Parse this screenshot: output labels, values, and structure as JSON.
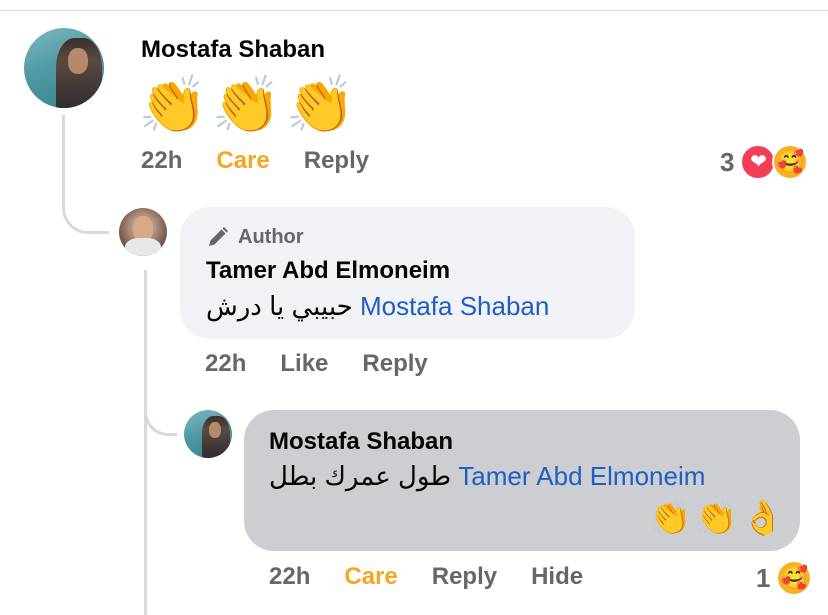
{
  "comment": {
    "author": "Mostafa Shaban",
    "content": "👏👏👏",
    "time": "22h",
    "reaction_label": "Care",
    "reply_label": "Reply",
    "reaction_count": "3",
    "reaction_icons": [
      "love-icon",
      "care-icon"
    ]
  },
  "reply_1": {
    "badge": "Author",
    "author": "Tamer Abd Elmoneim",
    "mention": "Mostafa Shaban",
    "text": "حبيبي يا درش",
    "time": "22h",
    "like_label": "Like",
    "reply_label": "Reply"
  },
  "reply_2": {
    "author": "Mostafa Shaban",
    "mention": "Tamer Abd Elmoneim",
    "text": "طول عمرك بطل",
    "emojis": "👏👏👌",
    "time": "22h",
    "reaction_label": "Care",
    "reply_label": "Reply",
    "hide_label": "Hide",
    "reaction_count": "1",
    "reaction_icons": [
      "care-icon"
    ]
  },
  "colors": {
    "care": "#f5a623",
    "mention": "#1f5fc4",
    "secondary_text": "#65676b",
    "bubble_default": "#f0f2f5",
    "bubble_highlighted": "#ccced2"
  }
}
